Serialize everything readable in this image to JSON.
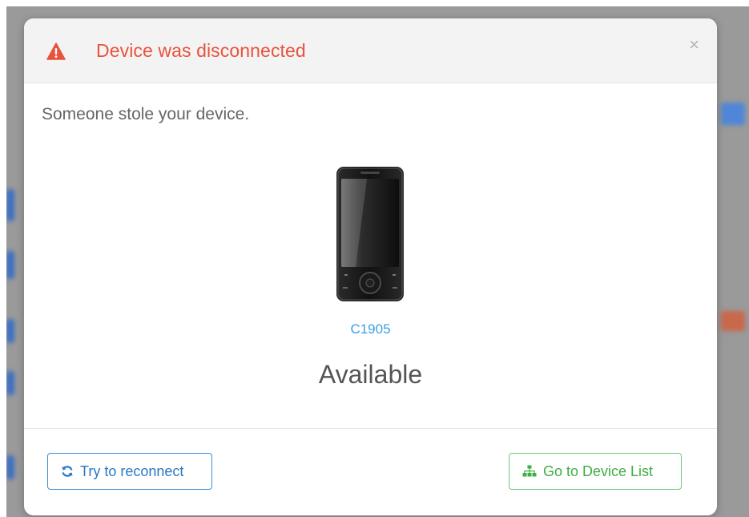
{
  "dialog": {
    "title": "Device was disconnected",
    "close_glyph": "×",
    "message": "Someone stole your device.",
    "device": {
      "model": "C1905",
      "status": "Available",
      "image": "phone-image"
    },
    "buttons": {
      "reconnect": {
        "label": "Try to reconnect",
        "icon": "refresh-icon"
      },
      "device_list": {
        "label": "Go to Device List",
        "icon": "sitemap-icon"
      }
    }
  },
  "colors": {
    "title": "#e8533d",
    "link": "#3ea0e3",
    "primary": "#2a78c5",
    "success": "#3fae44"
  }
}
